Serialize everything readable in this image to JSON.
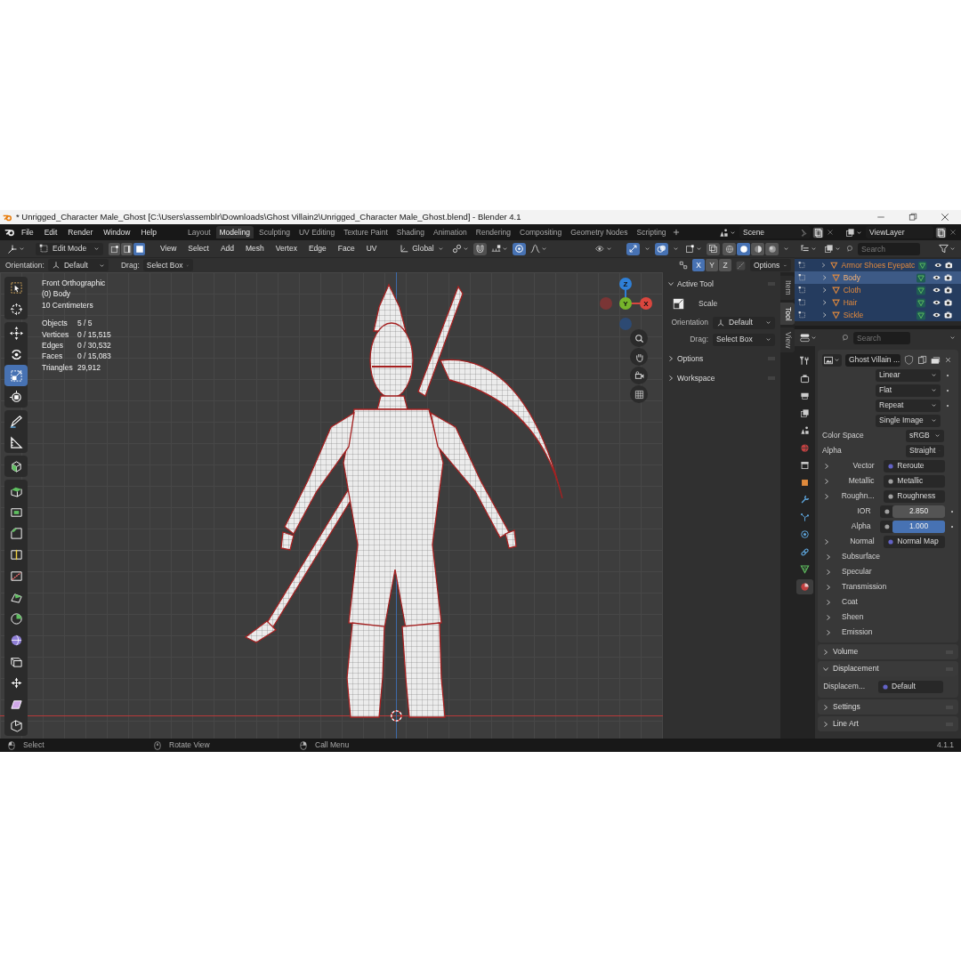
{
  "window": {
    "title": "* Unrigged_Character Male_Ghost [C:\\Users\\assemblr\\Downloads\\Ghost Villain2\\Unrigged_Character Male_Ghost.blend] - Blender 4.1"
  },
  "menu": [
    "File",
    "Edit",
    "Render",
    "Window",
    "Help"
  ],
  "workspaces": [
    {
      "label": "Layout",
      "selected": false
    },
    {
      "label": "Modeling",
      "selected": true
    },
    {
      "label": "Sculpting",
      "selected": false
    },
    {
      "label": "UV Editing",
      "selected": false
    },
    {
      "label": "Texture Paint",
      "selected": false
    },
    {
      "label": "Shading",
      "selected": false
    },
    {
      "label": "Animation",
      "selected": false
    },
    {
      "label": "Rendering",
      "selected": false
    },
    {
      "label": "Compositing",
      "selected": false
    },
    {
      "label": "Geometry Nodes",
      "selected": false
    },
    {
      "label": "Scripting",
      "selected": false
    }
  ],
  "scene": {
    "name": "Scene"
  },
  "view_layer": {
    "name": "ViewLayer"
  },
  "viewport_header": {
    "mode": "Edit Mode",
    "select_modes": [
      {
        "kind": "vertex",
        "selected": false
      },
      {
        "kind": "edge",
        "selected": false
      },
      {
        "kind": "face",
        "selected": true
      }
    ],
    "menus": [
      "View",
      "Select",
      "Add",
      "Mesh",
      "Vertex",
      "Edge",
      "Face",
      "UV"
    ],
    "orientation": "Global",
    "toggles": [
      {
        "kind": "snap",
        "on": false
      },
      {
        "kind": "proportional",
        "on": true
      }
    ],
    "overlay_toggles": [
      {
        "kind": "gizmo",
        "on": true
      },
      {
        "kind": "overlays",
        "on": true
      },
      {
        "kind": "xray",
        "on": false
      }
    ],
    "shading": [
      {
        "kind": "wireframe",
        "selected": false
      },
      {
        "kind": "solid",
        "selected": true
      },
      {
        "kind": "material",
        "selected": false
      },
      {
        "kind": "rendered",
        "selected": false
      }
    ]
  },
  "tool_settings": {
    "orientation_label": "Orientation:",
    "orientation": "Default",
    "drag_label": "Drag:",
    "drag": "Select Box",
    "axes": [
      {
        "label": "X",
        "selected": true
      },
      {
        "label": "Y",
        "selected": false
      },
      {
        "label": "Z",
        "selected": false
      }
    ],
    "options": "Options"
  },
  "toolbar": [
    {
      "tools": [
        {
          "kind": "select_box",
          "selected": false
        },
        {
          "kind": "cursor",
          "selected": false
        }
      ]
    },
    {
      "tools": [
        {
          "kind": "move",
          "selected": false
        },
        {
          "kind": "rotate",
          "selected": false
        },
        {
          "kind": "scale",
          "selected": true
        },
        {
          "kind": "transform",
          "selected": false
        }
      ]
    },
    {
      "tools": [
        {
          "kind": "annotate",
          "selected": false
        },
        {
          "kind": "measure",
          "selected": false
        }
      ]
    },
    {
      "tools": [
        {
          "kind": "add_cube",
          "selected": false
        }
      ]
    },
    {
      "tools": [
        {
          "kind": "extrude",
          "selected": false
        },
        {
          "kind": "inset",
          "selected": false
        },
        {
          "kind": "bevel",
          "selected": false
        },
        {
          "kind": "loop_cut",
          "selected": false
        },
        {
          "kind": "knife",
          "selected": false
        },
        {
          "kind": "poly_build",
          "selected": false
        },
        {
          "kind": "spin",
          "selected": false
        },
        {
          "kind": "smooth",
          "selected": false
        },
        {
          "kind": "edge_slide",
          "selected": false
        },
        {
          "kind": "shrink_fatten",
          "selected": false
        },
        {
          "kind": "shear",
          "selected": false
        },
        {
          "kind": "rip",
          "selected": false
        }
      ]
    }
  ],
  "overlay": {
    "view": [
      "Front Orthographic",
      "(0) Body",
      "10 Centimeters"
    ],
    "stats": [
      {
        "label": "Objects",
        "value": "5 / 5"
      },
      {
        "label": "Vertices",
        "value": "0 / 15,515"
      },
      {
        "label": "Edges",
        "value": "0 / 30,532"
      },
      {
        "label": "Faces",
        "value": "0 / 15,083"
      },
      {
        "label": "Triangles",
        "value": "29,912"
      }
    ]
  },
  "gizmo": [
    {
      "kind": "z",
      "label": "Z"
    },
    {
      "kind": "x",
      "label": "X"
    },
    {
      "kind": "neg_x"
    },
    {
      "kind": "neg_z"
    },
    {
      "kind": "y",
      "label": "Y"
    }
  ],
  "sidebar": {
    "tabs": [
      {
        "label": "Item",
        "selected": false
      },
      {
        "label": "Tool",
        "selected": true
      },
      {
        "label": "View",
        "selected": false
      }
    ],
    "active_tool": {
      "title": "Active Tool",
      "expanded": true,
      "tool": "Scale",
      "orientation_label": "Orientation",
      "orientation": "Default",
      "drag_label": "Drag:",
      "drag": "Select Box"
    },
    "panels": [
      {
        "title": "Options",
        "expanded": false
      },
      {
        "title": "Workspace",
        "expanded": false
      }
    ]
  },
  "outliner": {
    "search_placeholder": "Search",
    "rows": [
      {
        "name": "Armor Shoes Eyepatc",
        "selected": true,
        "active": false
      },
      {
        "name": "Body",
        "selected": true,
        "active": true
      },
      {
        "name": "Cloth",
        "selected": true,
        "active": false
      },
      {
        "name": "Hair",
        "selected": true,
        "active": false
      },
      {
        "name": "Sickle",
        "selected": true,
        "active": false
      }
    ]
  },
  "properties": {
    "search_placeholder": "Search",
    "tabs": [
      {
        "kind": "tool",
        "selected": false
      },
      {
        "kind": "render",
        "selected": false
      },
      {
        "kind": "output",
        "selected": false
      },
      {
        "kind": "view_layer",
        "selected": false
      },
      {
        "kind": "scene",
        "selected": false
      },
      {
        "kind": "world",
        "selected": false
      },
      {
        "kind": "collection",
        "selected": false
      },
      {
        "kind": "object",
        "selected": false
      },
      {
        "kind": "modifiers",
        "selected": false
      },
      {
        "kind": "particles",
        "selected": false
      },
      {
        "kind": "physics",
        "selected": false
      },
      {
        "kind": "constraints",
        "selected": false
      },
      {
        "kind": "data",
        "selected": false
      },
      {
        "kind": "material",
        "selected": true
      }
    ],
    "texture": "Ghost Villain ...",
    "image_settings": [
      {
        "value": "Linear",
        "keyframe": true
      },
      {
        "value": "Flat",
        "keyframe": true
      },
      {
        "value": "Repeat",
        "keyframe": true
      },
      {
        "value": "Single Image",
        "keyframe": false
      }
    ],
    "fields": [
      {
        "label": "Color Space",
        "value": "sRGB"
      },
      {
        "label": "Alpha",
        "value": "Straight"
      }
    ],
    "inputs": [
      {
        "kind": "link",
        "label": "Vector",
        "value": "Reroute",
        "expandable": true,
        "keyframe": false,
        "color": "#6363c7"
      },
      {
        "kind": "link",
        "label": "Metallic",
        "value": "Metallic",
        "expandable": true,
        "keyframe": false,
        "color": "#a1a1a1"
      },
      {
        "kind": "link",
        "label": "Roughn...",
        "value": "Roughness",
        "expandable": true,
        "keyframe": false,
        "color": "#a1a1a1"
      },
      {
        "kind": "number",
        "label": "IOR",
        "value": "2.850",
        "expandable": false,
        "keyframe": true,
        "color": "#a1a1a1"
      },
      {
        "kind": "slider",
        "label": "Alpha",
        "value": "1.000",
        "level": 1,
        "expandable": false,
        "keyframe": true,
        "color": "#a1a1a1"
      },
      {
        "kind": "link",
        "label": "Normal",
        "value": "Normal Map",
        "expandable": true,
        "keyframe": false,
        "color": "#6363c7"
      }
    ],
    "subpanels": [
      {
        "title": "Subsurface",
        "expanded": false
      },
      {
        "title": "Specular",
        "expanded": false
      },
      {
        "title": "Transmission",
        "expanded": false
      },
      {
        "title": "Coat",
        "expanded": false
      },
      {
        "title": "Sheen",
        "expanded": false
      },
      {
        "title": "Emission",
        "expanded": false
      }
    ],
    "panels": [
      {
        "title": "Volume",
        "expanded": false
      },
      {
        "title": "Displacement",
        "expanded": true,
        "rows": [
          {
            "label": "Displacem...",
            "value": "Default",
            "color": "#6363c7"
          }
        ]
      },
      {
        "title": "Settings",
        "expanded": false
      },
      {
        "title": "Line Art",
        "expanded": false
      }
    ]
  },
  "status_bar": {
    "hints": [
      {
        "kind": "left_click",
        "label": "Select"
      },
      {
        "kind": "middle_click",
        "label": "Rotate View"
      },
      {
        "kind": "right_click",
        "label": "Call Menu"
      }
    ],
    "version": "4.1.1"
  }
}
